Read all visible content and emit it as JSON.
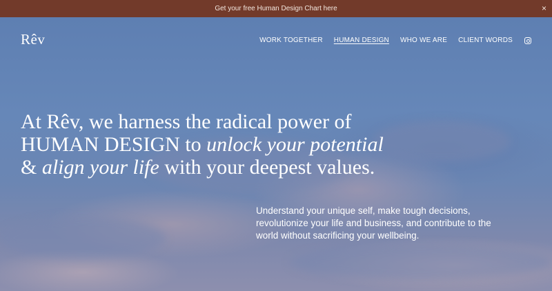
{
  "announcement": {
    "text": "Get your free Human Design Chart here",
    "close_glyph": "×"
  },
  "brand": {
    "logo": "Rêv"
  },
  "nav": {
    "items": [
      {
        "label": "WORK TOGETHER",
        "active": false
      },
      {
        "label": "HUMAN DESIGN",
        "active": true
      },
      {
        "label": "WHO WE ARE",
        "active": false
      },
      {
        "label": "CLIENT WORDS",
        "active": false
      }
    ],
    "social_icon": "instagram-icon"
  },
  "hero": {
    "headline": {
      "line1": "At Rêv, we harness the radical power of",
      "line2_plain": "HUMAN DESIGN to ",
      "line2_italic": "unlock your potential",
      "line3_lead": "& ",
      "line3_italic": "align your life",
      "line3_tail": " with your deepest values."
    },
    "subtext": "Understand your unique self, make tough decisions, revolutionize your life and business, and contribute to the world without sacrificing your wellbeing."
  },
  "colors": {
    "announcement_bg": "#723a2a",
    "sky": "#6687b8",
    "text": "#ffffff"
  }
}
